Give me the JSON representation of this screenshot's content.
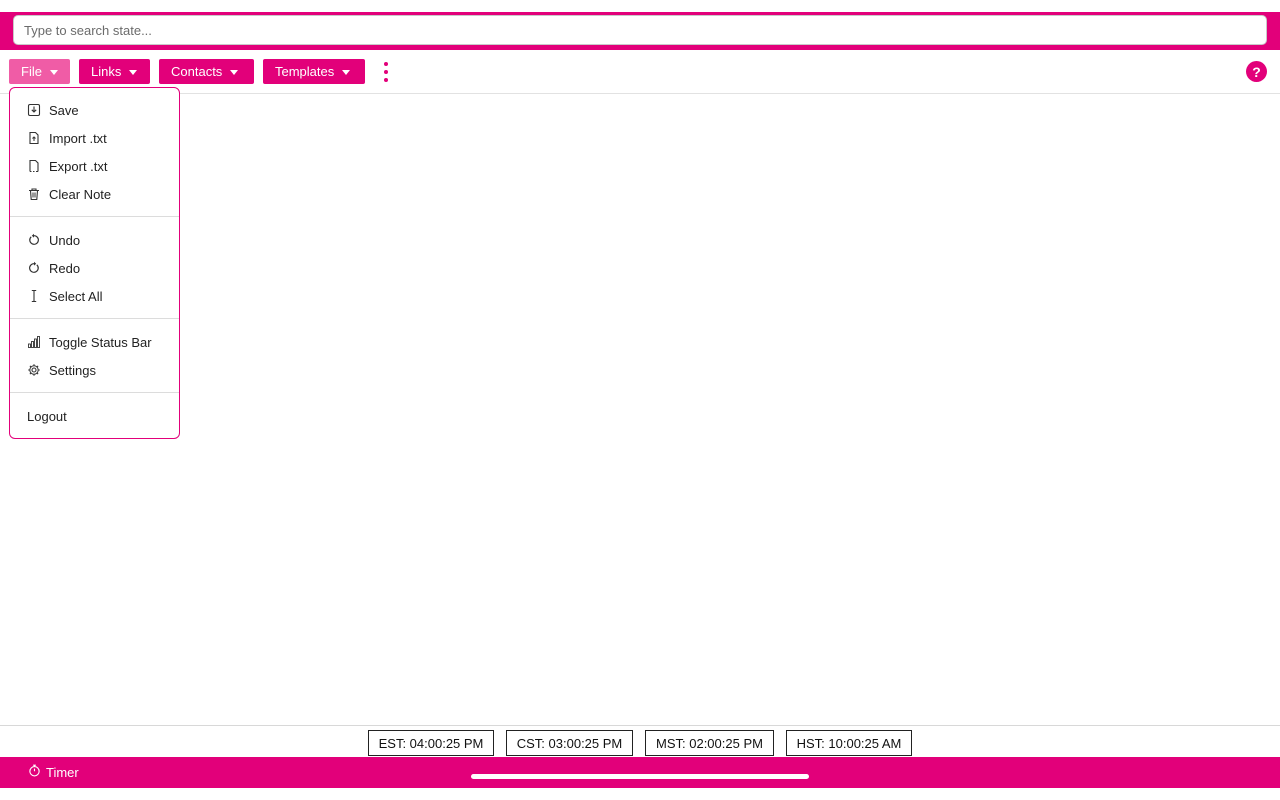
{
  "search": {
    "placeholder": "Type to search state..."
  },
  "menubar": {
    "file": "File",
    "links": "Links",
    "contacts": "Contacts",
    "templates": "Templates"
  },
  "help": {
    "label": "?"
  },
  "file_menu": {
    "save": "Save",
    "import_txt": "Import .txt",
    "export_txt": "Export .txt",
    "clear_note": "Clear Note",
    "undo": "Undo",
    "redo": "Redo",
    "select_all": "Select All",
    "toggle_status_bar": "Toggle Status Bar",
    "settings": "Settings",
    "logout": "Logout"
  },
  "clocks": {
    "est": "EST: 04:00:25 PM",
    "cst": "CST: 03:00:25 PM",
    "mst": "MST: 02:00:25 PM",
    "hst": "HST: 10:00:25 AM"
  },
  "footer": {
    "timer": "Timer"
  },
  "colors": {
    "accent": "#e2007a",
    "accent_light": "#f05ca6"
  },
  "icons": [
    "save-icon",
    "import-file-icon",
    "export-file-icon",
    "trash-icon",
    "undo-icon",
    "redo-icon",
    "text-cursor-icon",
    "signal-bars-icon",
    "gear-icon",
    "stopwatch-icon",
    "more-vertical-icon",
    "help-icon"
  ]
}
